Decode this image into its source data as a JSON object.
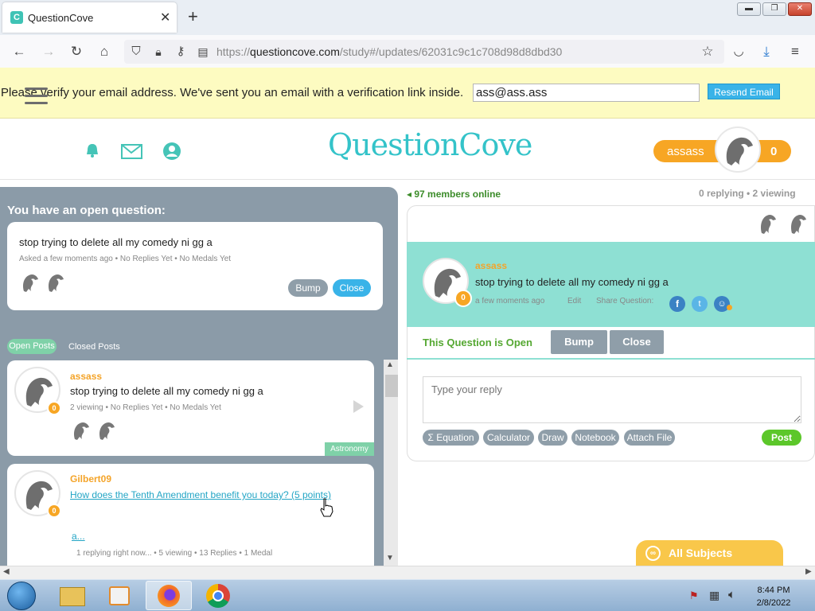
{
  "browser": {
    "tab_title": "QuestionCove",
    "tab_favicon": "C",
    "url_domain": "questioncove.com",
    "url_prefix": "https://",
    "url_path": "/study#/updates/62031c9c1c708d98d8dbd30"
  },
  "banner": {
    "text": "Please verify your email address. We've sent you an email with a verification link inside.",
    "email_value": "ass@ass.ass",
    "resend_label": "Resend Email"
  },
  "header": {
    "logo_main": "Question",
    "logo_accent": "Cove",
    "username": "assass",
    "score": "0"
  },
  "left": {
    "heading": "You have an open question:",
    "open_question": {
      "text": "stop trying to delete all my comedy ni gg a",
      "meta": "Asked a few moments ago  •  No Replies Yet  •  No Medals Yet",
      "bump_label": "Bump",
      "close_label": "Close"
    },
    "tab_open": "Open Posts",
    "tab_closed": "Closed Posts",
    "posts": [
      {
        "user": "assass",
        "badge": "0",
        "text": "stop trying to delete all my comedy ni gg a",
        "meta": "2 viewing  •  No Replies Yet  •  No Medals Yet",
        "subject": "Astronomy"
      },
      {
        "user": "Gilbert09",
        "badge": "0",
        "text": "How does the Tenth Amendment benefit you today? (5 points)",
        "extra": "a...",
        "meta": "1 replying right now...  •  5 viewing  •  13 Replies  •  1 Medal"
      }
    ]
  },
  "right": {
    "online": "97 members online",
    "replying": "0 replying  •  2 viewing",
    "question": {
      "user": "assass",
      "badge": "0",
      "text": "stop trying to delete all my comedy ni gg a",
      "time": "a few moments ago",
      "edit": "Edit",
      "share": "Share Question:"
    },
    "status": "This Question is Open",
    "bump_label": "Bump",
    "close_label": "Close",
    "reply_placeholder": "Type your reply",
    "tools": [
      "Σ  Equation",
      "Calculator",
      "Draw",
      "Notebook",
      "Attach File"
    ],
    "post_label": "Post",
    "all_subjects": "All Subjects"
  },
  "taskbar": {
    "time": "8:44 PM",
    "date": "2/8/2022"
  },
  "colors": {
    "accent": "#34c3c9",
    "orange": "#f7a624",
    "panel_grey": "#8b9ba8",
    "banner": "#fdfbc1",
    "green": "#5cc72a"
  }
}
